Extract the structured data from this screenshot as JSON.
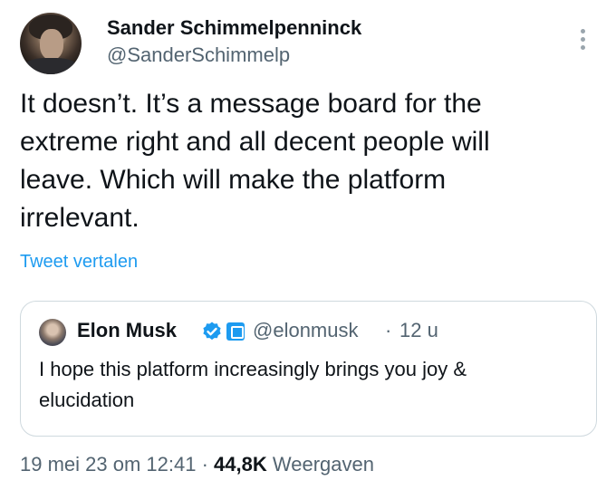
{
  "author": {
    "name": "Sander Schimmelpenninck",
    "handle": "@SanderSchimmelp"
  },
  "tweet": {
    "text": "It doesn’t. It’s a message board for the\nextreme right and all decent people will\nleave. Which will make the platform\nirrelevant.",
    "translate_label": "Tweet vertalen"
  },
  "quoted_tweet": {
    "name": "Elon Musk",
    "handle": "@elonmusk",
    "separator": "·",
    "time": "12 u",
    "text": "I hope this platform increasingly brings you joy &\nelucidation"
  },
  "meta": {
    "date": "19 mei 23 om 12:41",
    "separator": "·",
    "views_count": "44,8K",
    "views_label": "Weergaven"
  },
  "icons": {
    "more": "more-vertical-icon",
    "verified": "verified-badge-icon",
    "affiliation": "affiliation-badge-icon"
  },
  "colors": {
    "accent": "#1d9bf0",
    "text": "#0f1419",
    "secondary": "#536471",
    "border": "#cfd9de"
  }
}
